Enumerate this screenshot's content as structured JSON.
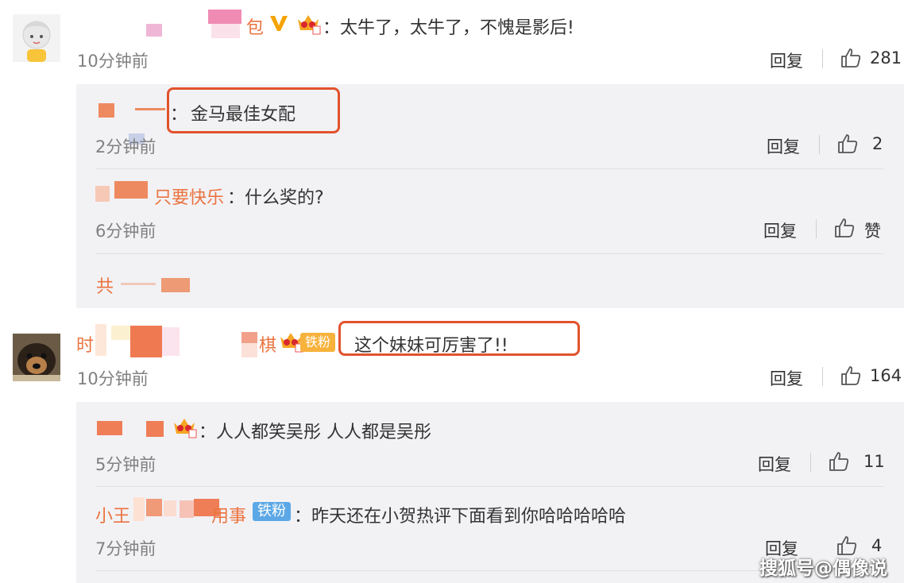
{
  "comments": [
    {
      "name_fragment": "包",
      "text": "：太牛了，太牛了，不愧是影后!",
      "time": "10分钟前",
      "reply_label": "回复",
      "likes": "281",
      "replies": [
        {
          "name_end": "：",
          "text": "金马最佳女配",
          "time": "2分钟前",
          "reply_label": "回复",
          "likes": "2"
        },
        {
          "name_fragment": "只要快乐",
          "text": "：什么奖的?",
          "time": "6分钟前",
          "reply_label": "回复",
          "likes": "赞"
        }
      ],
      "more_replies_fragment": "共"
    },
    {
      "name_fragment_start": "时",
      "name_fragment_end": "棋",
      "badge": "铁粉",
      "text": "这个妹妹可厉害了!!",
      "time": "10分钟前",
      "reply_label": "回复",
      "likes": "164",
      "replies": [
        {
          "text": "：人人都笑吴彤 人人都是吴彤",
          "time": "5分钟前",
          "reply_label": "回复",
          "likes": "11"
        },
        {
          "name_fragment_start": "小王",
          "name_fragment_end": "用事",
          "badge": "铁粉",
          "text": "：昨天还在小贺热评下面看到你哈哈哈哈哈",
          "time": "7分钟前",
          "reply_label": "回复",
          "likes": "4"
        }
      ]
    }
  ],
  "watermark": "搜狐号@偶像说",
  "colors": {
    "name": "#eb7340",
    "highlight": "#e2532d",
    "badge_orange": "#f5a623",
    "badge_blue": "#5ca8e6",
    "verified": "#f5a300"
  }
}
